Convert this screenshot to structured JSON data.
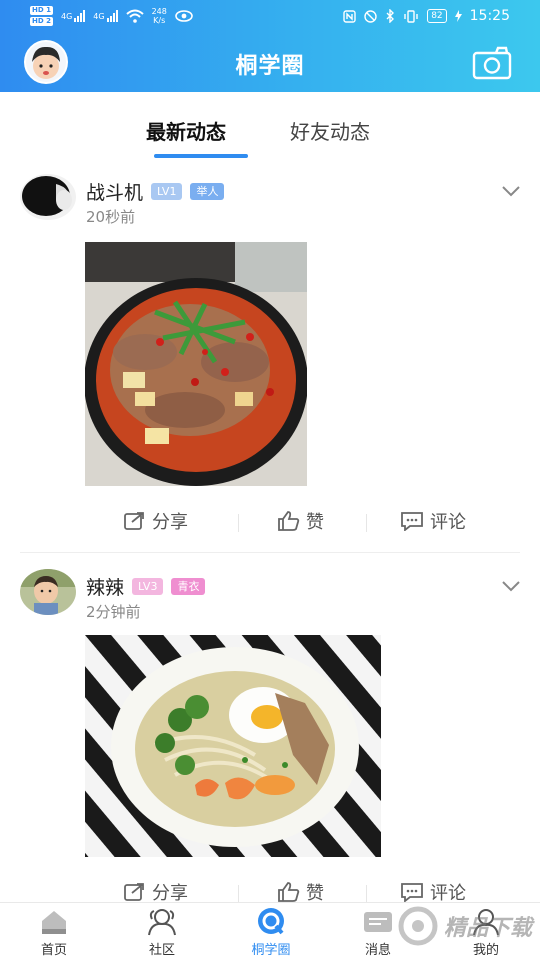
{
  "status_bar": {
    "sim_badges": [
      "HD 1",
      "HD 2"
    ],
    "signal_labels": [
      "4G",
      "4G"
    ],
    "speed_value": "248",
    "speed_unit": "K/s",
    "battery": "82",
    "time": "15:25"
  },
  "header": {
    "title": "桐学圈"
  },
  "tabs": [
    {
      "label": "最新动态",
      "active": true
    },
    {
      "label": "好友动态",
      "active": false
    }
  ],
  "posts": [
    {
      "username": "战斗机",
      "level": "LV1",
      "rank": "举人",
      "time": "20秒前",
      "image": "spicy-beef-hotpot-dish"
    },
    {
      "username": "辣辣",
      "level": "LV3",
      "rank": "青衣",
      "time": "2分钟前",
      "image": "noodle-bowl-with-egg-and-shrimp"
    }
  ],
  "actions": {
    "share": "分享",
    "like": "赞",
    "comment": "评论"
  },
  "bottom_nav": [
    {
      "label": "首页",
      "icon": "home-icon"
    },
    {
      "label": "社区",
      "icon": "community-icon"
    },
    {
      "label": "桐学圈",
      "icon": "circle-icon",
      "active": true
    },
    {
      "label": "消息",
      "icon": "message-icon"
    },
    {
      "label": "我的",
      "icon": "profile-icon"
    }
  ],
  "colors": {
    "accent": "#2f8cf0",
    "header_end": "#3cc8ee",
    "lv1_badge": "#a9c8f2",
    "rank1_badge": "#7aaef0",
    "lv3_badge": "#f3b6df",
    "rank3_badge": "#ef8ed0"
  },
  "watermark": "精品下载"
}
